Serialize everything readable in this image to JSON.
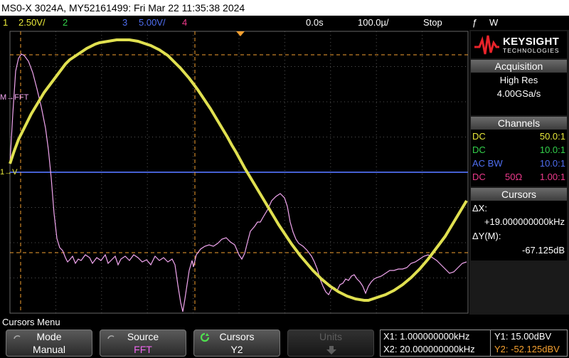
{
  "title": "MS0-X 3024A, MY52161499: Fri Mar 22 11:35:38 2024",
  "channels_bar": {
    "ch1_num": "1",
    "ch1_scale": "2.50V/",
    "ch2_num": "2",
    "ch3_num": "3",
    "ch3_scale": "5.00V/",
    "ch4_num": "4",
    "time_offset": "0.0s",
    "time_scale": "100.0µ/",
    "run_state": "Stop",
    "trigger_icon": "ƒ",
    "trigger_source": "W"
  },
  "logo": {
    "brand": "KEYSIGHT",
    "sub": "TECHNOLOGIES"
  },
  "acquisition": {
    "heading": "Acquisition",
    "mode": "High Res",
    "rate": "4.00GSa/s"
  },
  "channels": {
    "heading": "Channels",
    "rows": [
      {
        "coupling": "DC",
        "mid": "",
        "ratio": "50.0:1",
        "color": "#e8e83a"
      },
      {
        "coupling": "DC",
        "mid": "",
        "ratio": "10.0:1",
        "color": "#33d24b"
      },
      {
        "coupling": "AC BW",
        "mid": "",
        "ratio": "10.0:1",
        "color": "#4f6ef0"
      },
      {
        "coupling": "DC",
        "mid": "50Ω",
        "ratio": "1.00:1",
        "color": "#ee3a8c"
      }
    ]
  },
  "cursors": {
    "heading": "Cursors",
    "dx_label": "ΔX:",
    "dx_value": "+19.000000000kHz",
    "dy_label": "ΔY(M):",
    "dy_value": "-67.125dB"
  },
  "markers": {
    "fft": "M→FFT",
    "ch1": "1→V"
  },
  "menu": {
    "title": "Cursors Menu",
    "mode_label": "Mode",
    "mode_value": "Manual",
    "source_label": "Source",
    "source_value": "FFT",
    "cursors_label": "Cursors",
    "cursors_value": "Y2",
    "units_label": "Units"
  },
  "readout": {
    "x1": "X1: 1.000000000kHz",
    "x2": "X2: 20.000000000kHz",
    "y1": "Y1: 15.00dBV",
    "y2": "Y2: -52.125dBV"
  },
  "colors": {
    "ch1": "#e8e83a",
    "ch2": "#33d24b",
    "ch3": "#4f6ef0",
    "ch4": "#ee3a8c",
    "fft": "#f2a6f0",
    "cursor": "#f5a030",
    "accent": "#5577ff"
  }
}
